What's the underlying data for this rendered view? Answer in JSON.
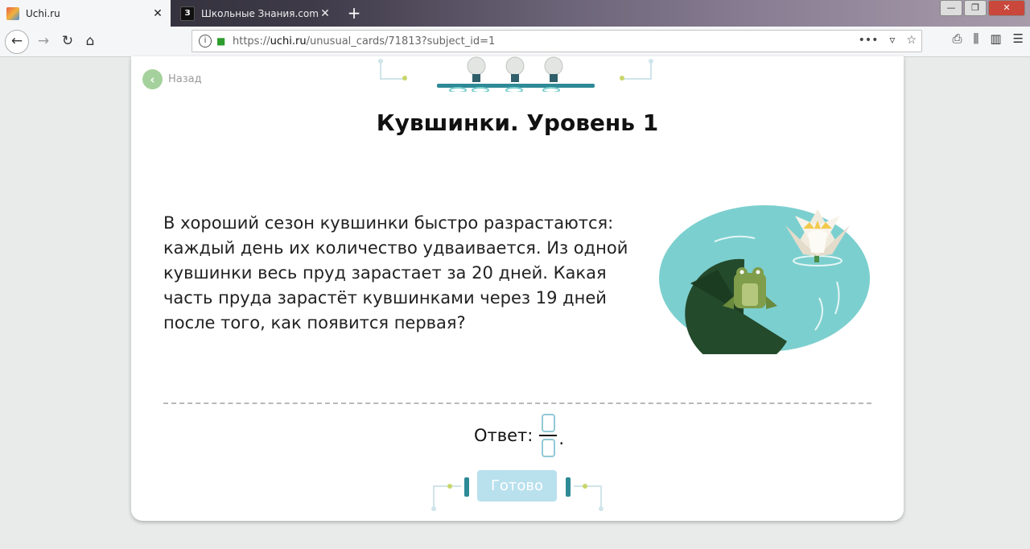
{
  "browser": {
    "tabs": [
      {
        "title": "Uchi.ru",
        "favicon": "uchi-favicon",
        "active": true
      },
      {
        "title": "Школьные Знания.com - Реш",
        "favicon_letter": "З",
        "active": false
      }
    ],
    "new_tab_symbol": "+",
    "url": {
      "scheme": "https://",
      "host": "uchi.ru",
      "path": "/unusual_cards/71813?subject_id=1"
    }
  },
  "page": {
    "back_label": "Назад",
    "title": "Кувшинки. Уровень 1",
    "problem_text": "В хороший сезон кувшинки быстро разрастаются: каждый день их количество удваивается. Из одной кувшинки весь пруд зарастает за 20 дней. Какая часть пруда зарастёт кувшинками через 19 дней после того, как появится первая?",
    "answer_label": "Ответ:",
    "answer_suffix": ".",
    "submit_label": "Готово"
  },
  "colors": {
    "back_circle": "#a5d19c",
    "pond": "#7ccfcf",
    "lily_pad": "#234a2b",
    "frog": "#7f9d4a",
    "submit_bg": "#b9e0ed",
    "input_border": "#92c8d6"
  }
}
